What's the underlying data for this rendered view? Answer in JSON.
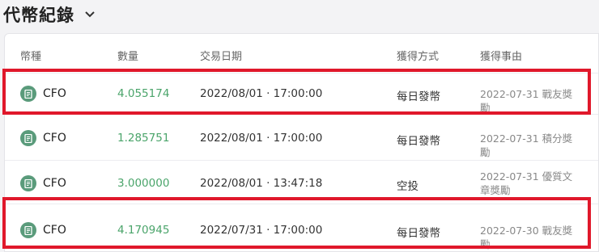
{
  "page": {
    "title": "代幣紀錄"
  },
  "table": {
    "headers": {
      "currency": "幣種",
      "amount": "數量",
      "date": "交易日期",
      "method": "獲得方式",
      "reason": "獲得事由"
    },
    "rows": [
      {
        "currency": "CFO",
        "amount": "4.055174",
        "date": "2022/08/01 · 17:00:00",
        "method": "每日發幣",
        "reason": "2022-07-31 戰友獎勵",
        "highlighted": true
      },
      {
        "currency": "CFO",
        "amount": "1.285751",
        "date": "2022/08/01 · 17:00:00",
        "method": "每日發幣",
        "reason": "2022-07-31 積分獎勵",
        "highlighted": false
      },
      {
        "currency": "CFO",
        "amount": "3.000000",
        "date": "2022/08/01 · 13:47:18",
        "method": "空投",
        "reason": "2022-07-31 優質文章獎勵",
        "highlighted": false
      },
      {
        "currency": "CFO",
        "amount": "4.170945",
        "date": "2022/07/31 · 17:00:00",
        "method": "每日發幣",
        "reason": "2022-07-30 戰友獎勵",
        "highlighted": true
      }
    ]
  },
  "colors": {
    "amount": "#4aa46a",
    "coin_icon": "#5a9b7b",
    "highlight": "#e0182b"
  },
  "icons": {
    "title_toggle": "chevron-down-icon",
    "coin": "cfo-coin-icon"
  }
}
